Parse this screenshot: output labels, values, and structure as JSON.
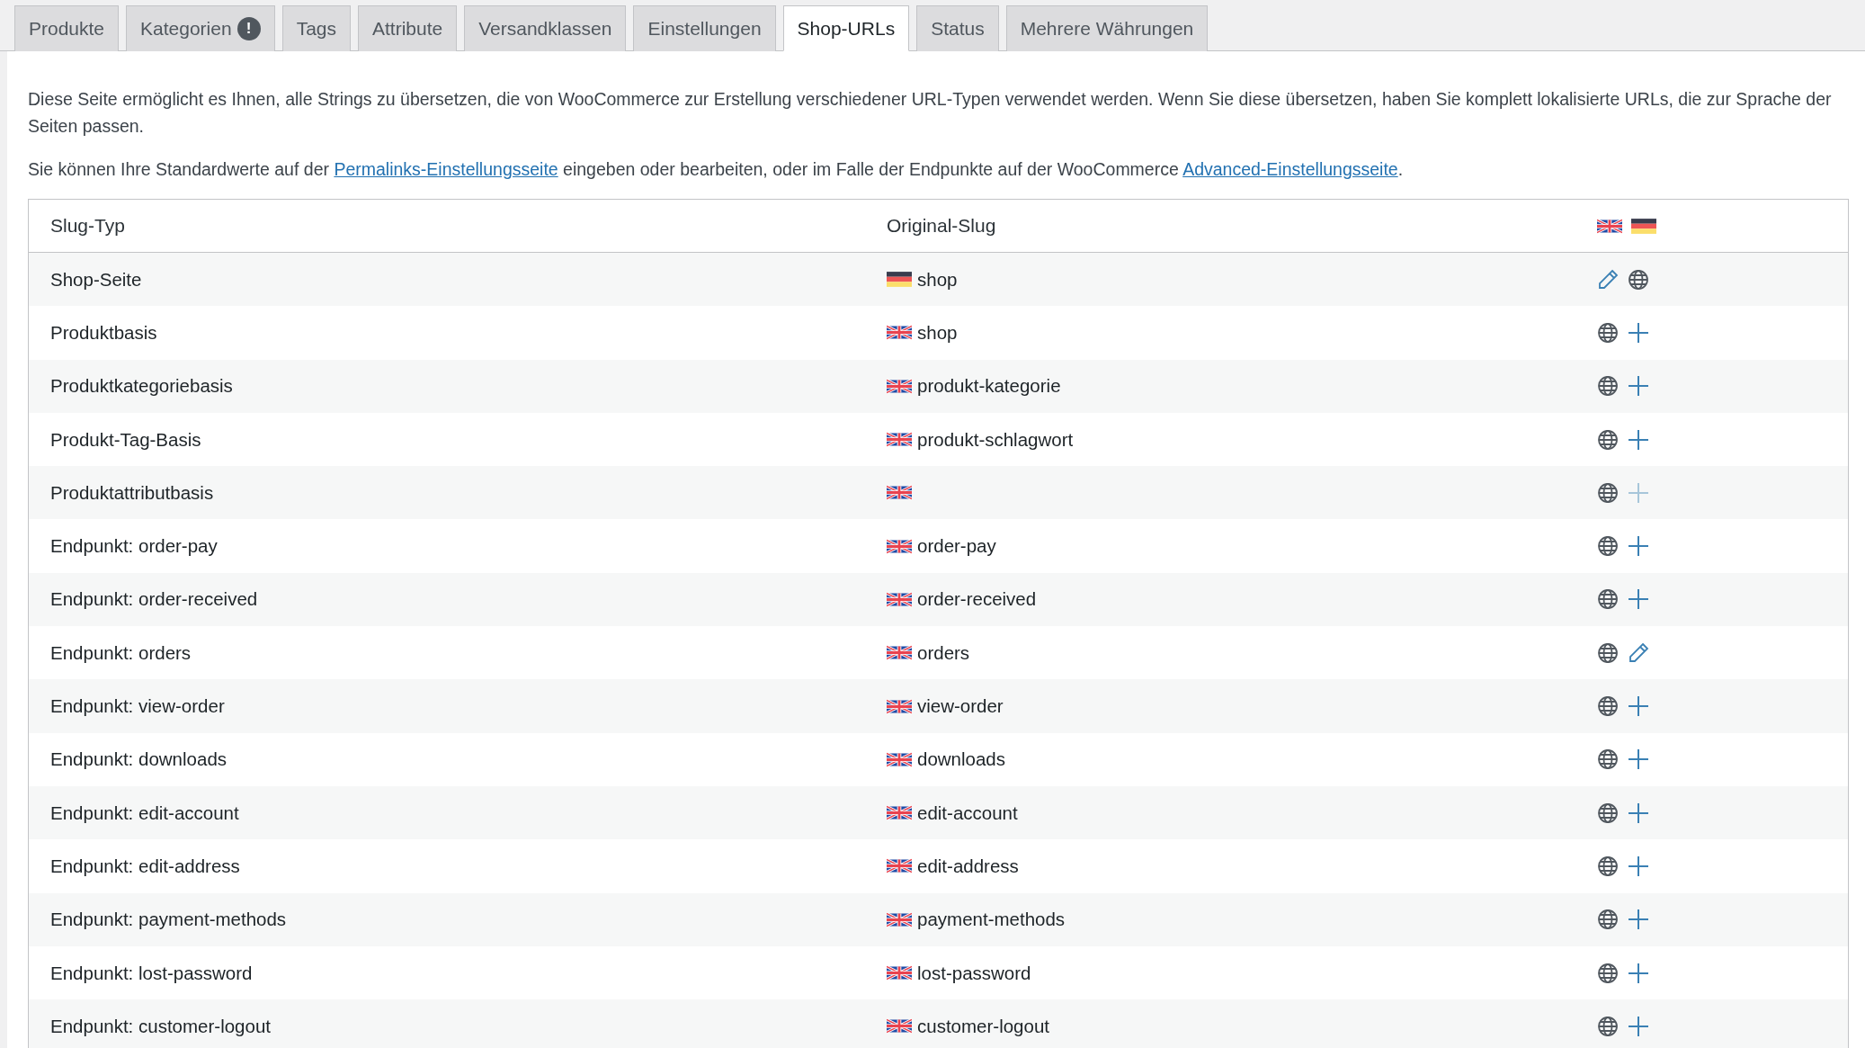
{
  "tabs": [
    {
      "label": "Produkte",
      "selected": false
    },
    {
      "label": "Kategorien",
      "selected": false,
      "badge": "!"
    },
    {
      "label": "Tags",
      "selected": false
    },
    {
      "label": "Attribute",
      "selected": false
    },
    {
      "label": "Versandklassen",
      "selected": false
    },
    {
      "label": "Einstellungen",
      "selected": false
    },
    {
      "label": "Shop-URLs",
      "selected": true
    },
    {
      "label": "Status",
      "selected": false
    },
    {
      "label": "Mehrere Währungen",
      "selected": false
    }
  ],
  "intro": "Diese Seite ermöglicht es Ihnen, alle Strings zu übersetzen, die von WooCommerce zur Erstellung verschiedener URL-Typen verwendet werden. Wenn Sie diese übersetzen, haben Sie komplett lokalisierte URLs, die zur Sprache der Seiten passen.",
  "note": {
    "before": "Sie können Ihre Standardwerte auf der",
    "link1": "Permalinks-Einstellungsseite",
    "middle": "eingeben oder bearbeiten, oder im Falle der Endpunkte auf der WooCommerce",
    "link2": "Advanced-Einstellungsseite",
    "after": "."
  },
  "table": {
    "columns": [
      "Slug-Typ",
      "Original-Slug"
    ],
    "language_flags": [
      {
        "kind": "gb"
      },
      {
        "kind": "de"
      }
    ],
    "rows": [
      {
        "type": "Shop-Seite",
        "flag": {
          "kind": "de"
        },
        "slug": "shop",
        "actions": [
          {
            "kind": "edit",
            "disabled": false
          },
          {
            "kind": "globe",
            "disabled": false
          }
        ]
      },
      {
        "type": "Produktbasis",
        "flag": {
          "kind": "gb"
        },
        "slug": "shop",
        "actions": [
          {
            "kind": "globe",
            "disabled": false
          },
          {
            "kind": "add",
            "disabled": false
          }
        ]
      },
      {
        "type": "Produktkategoriebasis",
        "flag": {
          "kind": "gb"
        },
        "slug": "produkt-kategorie",
        "actions": [
          {
            "kind": "globe",
            "disabled": false
          },
          {
            "kind": "add",
            "disabled": false
          }
        ]
      },
      {
        "type": "Produkt-Tag-Basis",
        "flag": {
          "kind": "gb"
        },
        "slug": "produkt-schlagwort",
        "actions": [
          {
            "kind": "globe",
            "disabled": false
          },
          {
            "kind": "add",
            "disabled": false
          }
        ]
      },
      {
        "type": "Produktattributbasis",
        "flag": {
          "kind": "gb"
        },
        "actions": [
          {
            "kind": "globe",
            "disabled": false
          },
          {
            "kind": "add",
            "disabled": true
          }
        ]
      },
      {
        "type": "Endpunkt: order-pay",
        "flag": {
          "kind": "gb"
        },
        "slug": "order-pay",
        "actions": [
          {
            "kind": "globe",
            "disabled": false
          },
          {
            "kind": "add",
            "disabled": false
          }
        ]
      },
      {
        "type": "Endpunkt: order-received",
        "flag": {
          "kind": "gb"
        },
        "slug": "order-received",
        "actions": [
          {
            "kind": "globe",
            "disabled": false
          },
          {
            "kind": "add",
            "disabled": false
          }
        ]
      },
      {
        "type": "Endpunkt: orders",
        "flag": {
          "kind": "gb"
        },
        "slug": "orders",
        "actions": [
          {
            "kind": "globe",
            "disabled": false
          },
          {
            "kind": "edit",
            "disabled": false
          }
        ]
      },
      {
        "type": "Endpunkt: view-order",
        "flag": {
          "kind": "gb"
        },
        "slug": "view-order",
        "actions": [
          {
            "kind": "globe",
            "disabled": false
          },
          {
            "kind": "add",
            "disabled": false
          }
        ]
      },
      {
        "type": "Endpunkt: downloads",
        "flag": {
          "kind": "gb"
        },
        "slug": "downloads",
        "actions": [
          {
            "kind": "globe",
            "disabled": false
          },
          {
            "kind": "add",
            "disabled": false
          }
        ]
      },
      {
        "type": "Endpunkt: edit-account",
        "flag": {
          "kind": "gb"
        },
        "slug": "edit-account",
        "actions": [
          {
            "kind": "globe",
            "disabled": false
          },
          {
            "kind": "add",
            "disabled": false
          }
        ]
      },
      {
        "type": "Endpunkt: edit-address",
        "flag": {
          "kind": "gb"
        },
        "slug": "edit-address",
        "actions": [
          {
            "kind": "globe",
            "disabled": false
          },
          {
            "kind": "add",
            "disabled": false
          }
        ]
      },
      {
        "type": "Endpunkt: payment-methods",
        "flag": {
          "kind": "gb"
        },
        "slug": "payment-methods",
        "actions": [
          {
            "kind": "globe",
            "disabled": false
          },
          {
            "kind": "add",
            "disabled": false
          }
        ]
      },
      {
        "type": "Endpunkt: lost-password",
        "flag": {
          "kind": "gb"
        },
        "slug": "lost-password",
        "actions": [
          {
            "kind": "globe",
            "disabled": false
          },
          {
            "kind": "add",
            "disabled": false
          }
        ]
      },
      {
        "type": "Endpunkt: customer-logout",
        "flag": {
          "kind": "gb"
        },
        "slug": "customer-logout",
        "actions": [
          {
            "kind": "globe",
            "disabled": false
          },
          {
            "kind": "add",
            "disabled": false
          }
        ]
      }
    ]
  }
}
